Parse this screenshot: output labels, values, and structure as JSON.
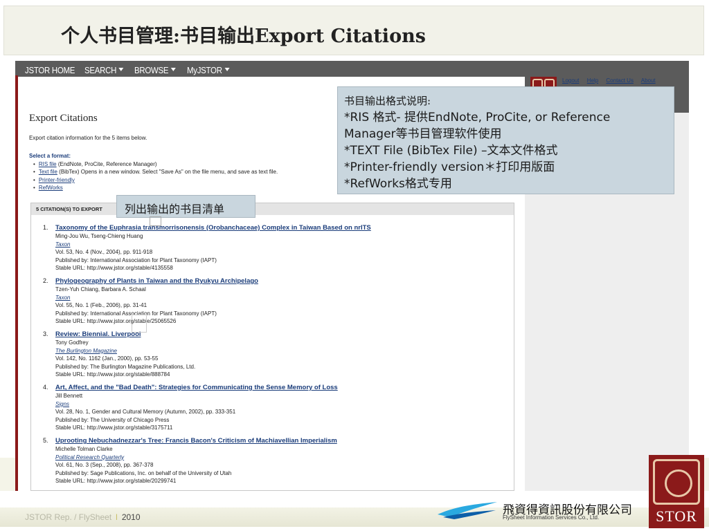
{
  "slide": {
    "title": "个人书目管理:书目输出Export Citations",
    "footer_left": "JSTOR  Rep. / FlySheet",
    "footer_sep": "l",
    "footer_year": "2010",
    "company_cn": "飛資得資訊股份有限公司",
    "company_en": "FlySheet Information Services Co., Ltd.",
    "jstor_logo_text": "STOR"
  },
  "nav": {
    "home": "JSTOR HOME",
    "search": "SEARCH",
    "browse": "BROWSE",
    "myjstor": "MyJSTOR",
    "top_links": [
      "Logout",
      "Help",
      "Contact Us",
      "About"
    ]
  },
  "page": {
    "title": "Export Citations",
    "description": "Export citation information for the 5 items below.",
    "select_format": "Select a format:",
    "formats": [
      {
        "link": "RIS file",
        "desc": " (EndNote, ProCite, Reference Manager)"
      },
      {
        "link": "Text file",
        "desc": " (BibTex) Opens in a new window. Select \"Save As\" on the file menu, and save as text file."
      },
      {
        "link": "Printer-friendly",
        "desc": ""
      },
      {
        "link": "RefWorks",
        "desc": ""
      }
    ],
    "citations_header": "5 CITATION(S) TO EXPORT"
  },
  "citations": [
    {
      "num": "1.",
      "title": "Taxonomy of the Euphrasia transmorrisonensis (Orobanchaceae) Complex in Taiwan Based on nrITS",
      "authors": "Ming-Jou Wu, Tseng-Chieng Huang",
      "journal": "Taxon",
      "volume": "Vol. 53, No. 4 (Nov., 2004), pp. 911-918",
      "publisher": "Published by: International Association for Plant Taxonomy (IAPT)",
      "url": "Stable URL: http://www.jstor.org/stable/4135558"
    },
    {
      "num": "2.",
      "title": "Phylogeography of Plants in Taiwan and the Ryukyu Archipelago",
      "authors": "Tzen-Yuh Chiang, Barbara A. Schaal",
      "journal": "Taxon",
      "volume": "Vol. 55, No. 1 (Feb., 2006), pp. 31-41",
      "publisher": "Published by: International Association for Plant Taxonomy (IAPT)",
      "url": "Stable URL: http://www.jstor.org/stable/25065526"
    },
    {
      "num": "3.",
      "title": "Review: Biennial. Liverpool",
      "authors": "Tony Godfrey",
      "journal": "The Burlington Magazine",
      "volume": "Vol. 142, No. 1162 (Jan., 2000), pp. 53-55",
      "publisher": "Published by: The Burlington Magazine Publications, Ltd.",
      "url": "Stable URL: http://www.jstor.org/stable/888784"
    },
    {
      "num": "4.",
      "title": "Art, Affect, and the \"Bad Death\": Strategies for Communicating the Sense Memory of Loss",
      "authors": "Jill Bennett",
      "journal": "Signs",
      "volume": "Vol. 28, No. 1, Gender and Cultural Memory (Autumn, 2002), pp. 333-351",
      "publisher": "Published by: The University of Chicago Press",
      "url": "Stable URL: http://www.jstor.org/stable/3175711"
    },
    {
      "num": "5.",
      "title": "Uprooting Nebuchadnezzar's Tree: Francis Bacon's Criticism of Machiavellian Imperialism",
      "authors": "Michelle Tolman Clarke",
      "journal": "Political Research Quarterly",
      "volume": "Vol. 61, No. 3 (Sep., 2008), pp. 367-378",
      "publisher": "Published by: Sage Publications, Inc. on behalf of the University of Utah",
      "url": "Stable URL: http://www.jstor.org/stable/20299741"
    }
  ],
  "callouts": {
    "info_lines": [
      "书目输出格式说明:",
      "*RIS 格式- 提供EndNote, ProCite, or Reference",
      "Manager等书目管理软件使用",
      "*TEXT File (BibTex File) –文本文件格式",
      "*Printer-friendly version＊打印用版面",
      "*RefWorks格式专用"
    ],
    "list_label": "列出输出的书目清单"
  },
  "colors": {
    "brand_red": "#8b1a1a",
    "link_blue": "#1a3c7a",
    "callout_bg": "#c9d6de",
    "nav_gray": "#5b5b5b"
  }
}
